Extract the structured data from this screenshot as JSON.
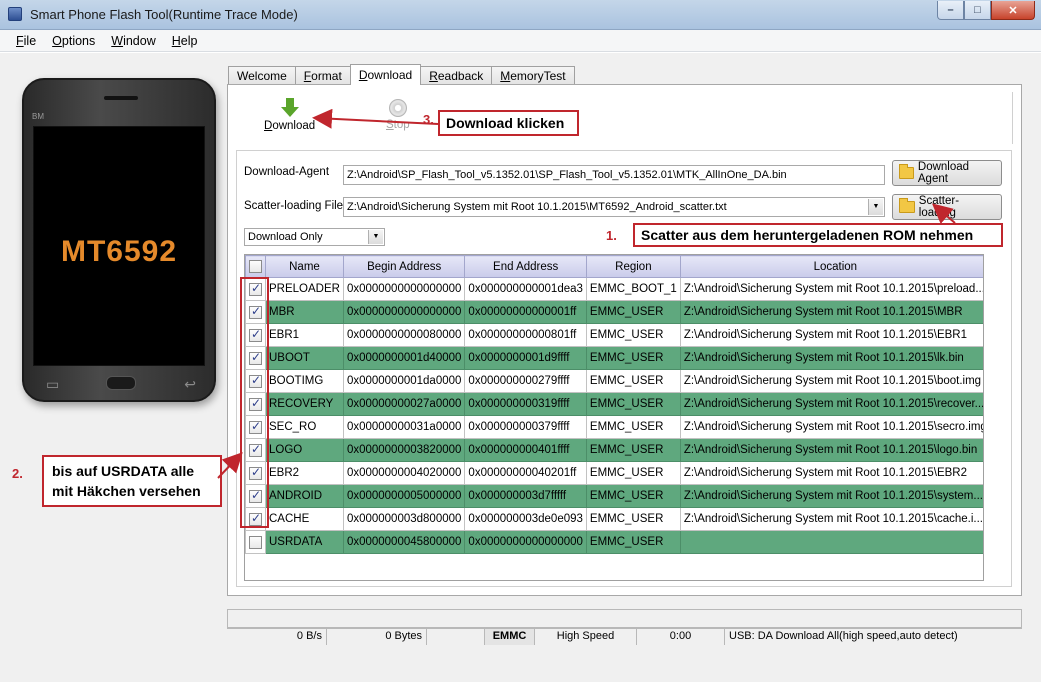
{
  "window": {
    "title": "Smart Phone Flash Tool(Runtime Trace Mode)",
    "minimize": "–",
    "maximize": "□",
    "close": "✕"
  },
  "menu": {
    "file": "File",
    "options": "Options",
    "window": "Window",
    "help": "Help"
  },
  "phone": {
    "brand": "BM",
    "model": "MT6592"
  },
  "tabs": [
    "Welcome",
    "Format",
    "Download",
    "Readback",
    "MemoryTest"
  ],
  "toolbar": {
    "download": "Download",
    "stop": "Stop"
  },
  "form": {
    "download_agent_label": "Download-Agent",
    "download_agent_path": "Z:\\Android\\SP_Flash_Tool_v5.1352.01\\SP_Flash_Tool_v5.1352.01\\MTK_AllInOne_DA.bin",
    "download_agent_button": "Download Agent",
    "scatter_label": "Scatter-loading File",
    "scatter_path": "Z:\\Android\\Sicherung System mit Root 10.1.2015\\MT6592_Android_scatter.txt",
    "scatter_button": "Scatter-loading",
    "mode": "Download Only"
  },
  "table": {
    "columns": [
      "Name",
      "Begin Address",
      "End Address",
      "Region",
      "Location"
    ],
    "rows": [
      {
        "checked": true,
        "name": "PRELOADER",
        "begin": "0x0000000000000000",
        "end": "0x000000000001dea3",
        "region": "EMMC_BOOT_1",
        "location": "Z:\\Android\\Sicherung System mit Root 10.1.2015\\preload..."
      },
      {
        "checked": true,
        "name": "MBR",
        "begin": "0x0000000000000000",
        "end": "0x00000000000001ff",
        "region": "EMMC_USER",
        "location": "Z:\\Android\\Sicherung System mit Root 10.1.2015\\MBR"
      },
      {
        "checked": true,
        "name": "EBR1",
        "begin": "0x0000000000080000",
        "end": "0x00000000000801ff",
        "region": "EMMC_USER",
        "location": "Z:\\Android\\Sicherung System mit Root 10.1.2015\\EBR1"
      },
      {
        "checked": true,
        "name": "UBOOT",
        "begin": "0x0000000001d40000",
        "end": "0x0000000001d9ffff",
        "region": "EMMC_USER",
        "location": "Z:\\Android\\Sicherung System mit Root 10.1.2015\\lk.bin"
      },
      {
        "checked": true,
        "name": "BOOTIMG",
        "begin": "0x0000000001da0000",
        "end": "0x000000000279ffff",
        "region": "EMMC_USER",
        "location": "Z:\\Android\\Sicherung System mit Root 10.1.2015\\boot.img"
      },
      {
        "checked": true,
        "name": "RECOVERY",
        "begin": "0x00000000027a0000",
        "end": "0x000000000319ffff",
        "region": "EMMC_USER",
        "location": "Z:\\Android\\Sicherung System mit Root 10.1.2015\\recover..."
      },
      {
        "checked": true,
        "name": "SEC_RO",
        "begin": "0x00000000031a0000",
        "end": "0x000000000379ffff",
        "region": "EMMC_USER",
        "location": "Z:\\Android\\Sicherung System mit Root 10.1.2015\\secro.img"
      },
      {
        "checked": true,
        "name": "LOGO",
        "begin": "0x0000000003820000",
        "end": "0x000000000401ffff",
        "region": "EMMC_USER",
        "location": "Z:\\Android\\Sicherung System mit Root 10.1.2015\\logo.bin"
      },
      {
        "checked": true,
        "name": "EBR2",
        "begin": "0x0000000004020000",
        "end": "0x00000000040201ff",
        "region": "EMMC_USER",
        "location": "Z:\\Android\\Sicherung System mit Root 10.1.2015\\EBR2"
      },
      {
        "checked": true,
        "name": "ANDROID",
        "begin": "0x0000000005000000",
        "end": "0x000000003d7fffff",
        "region": "EMMC_USER",
        "location": "Z:\\Android\\Sicherung System mit Root 10.1.2015\\system...."
      },
      {
        "checked": true,
        "name": "CACHE",
        "begin": "0x000000003d800000",
        "end": "0x000000003de0e093",
        "region": "EMMC_USER",
        "location": "Z:\\Android\\Sicherung System mit Root 10.1.2015\\cache.i..."
      },
      {
        "checked": false,
        "name": "USRDATA",
        "begin": "0x0000000045800000",
        "end": "0x0000000000000000",
        "region": "EMMC_USER",
        "location": ""
      }
    ]
  },
  "status": {
    "speed": "0 B/s",
    "bytes": "0 Bytes",
    "storage": "EMMC",
    "mode": "High Speed",
    "time": "0:00",
    "usb": "USB: DA Download All(high speed,auto detect)"
  },
  "annotations": {
    "step1_num": "1.",
    "step1_text": "Scatter aus dem heruntergeladenen ROM nehmen",
    "step2_num": "2.",
    "step2_line1": "bis auf USRDATA alle",
    "step2_line2": "mit Häkchen versehen",
    "step3_num": "3.",
    "step3_text": "Download klicken"
  },
  "colors": {
    "alt_row": "#5fa87e",
    "annotation": "#c0262d",
    "chip_text": "#e58a2b"
  }
}
